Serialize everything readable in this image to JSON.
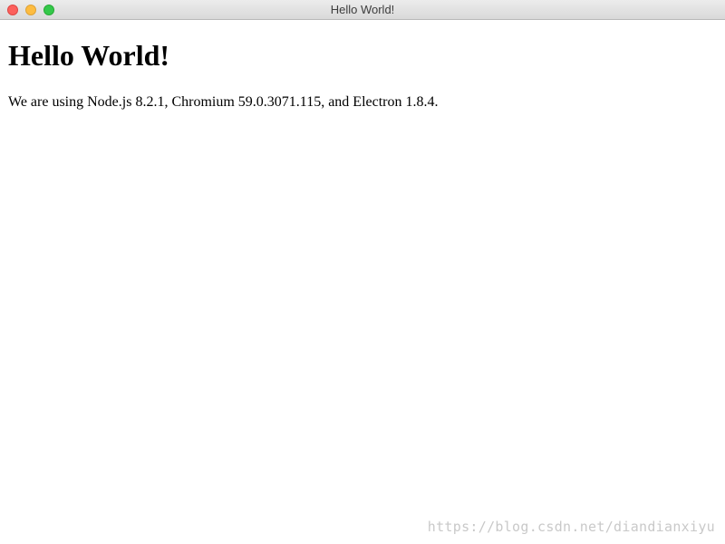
{
  "window": {
    "title": "Hello World!",
    "controls": {
      "close_color": "#fc605c",
      "minimize_color": "#fdbc40",
      "maximize_color": "#34c84a"
    }
  },
  "page": {
    "heading": "Hello World!",
    "body_text": "We are using Node.js 8.2.1, Chromium 59.0.3071.115, and Electron 1.8.4."
  },
  "watermark": {
    "text": "https://blog.csdn.net/diandianxiyu"
  }
}
